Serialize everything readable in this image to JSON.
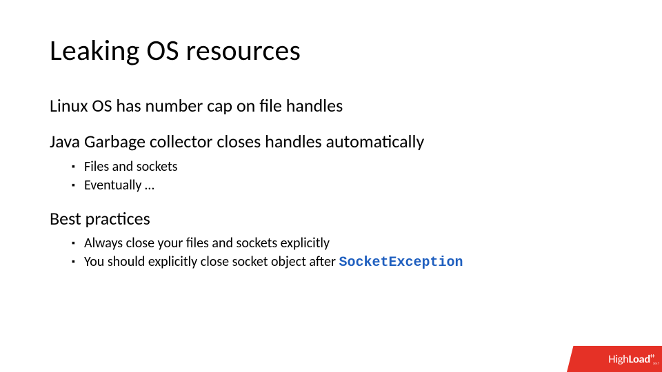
{
  "title": "Leaking OS resources",
  "sections": [
    {
      "heading": "Linux OS has number cap on file handles",
      "bullets": []
    },
    {
      "heading": "Java Garbage collector closes handles automatically",
      "bullets": [
        {
          "text": "Files and sockets"
        },
        {
          "text": "Eventually …"
        }
      ]
    },
    {
      "heading": "Best practices",
      "bullets": [
        {
          "text": "Always close your files and sockets explicitly"
        },
        {
          "text": "You should explicitly close socket object after ",
          "code": "SocketException"
        }
      ]
    }
  ],
  "logo": {
    "text_light": "High",
    "text_bold": "Load",
    "plus": "++",
    "year": "2017"
  }
}
